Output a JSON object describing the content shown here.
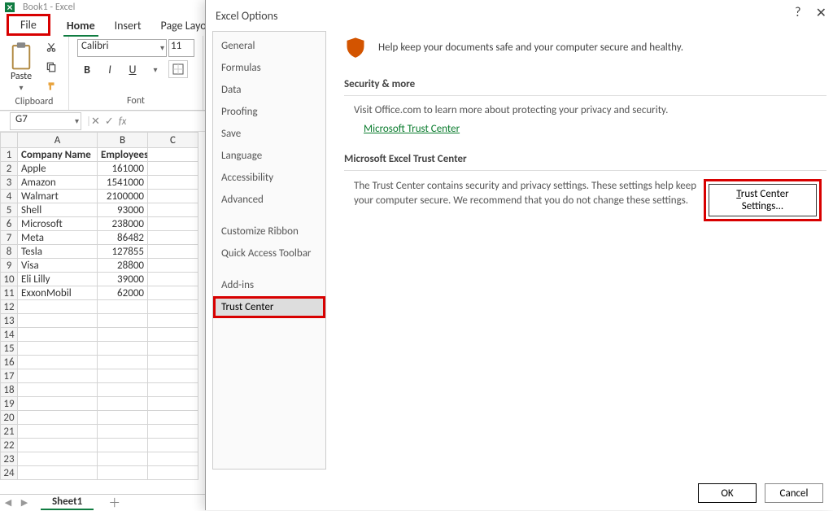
{
  "title": "Book1 - Excel",
  "ribbon": {
    "tabs": [
      "File",
      "Home",
      "Insert",
      "Page Layout"
    ],
    "active": 1,
    "clipboard_label": "Clipboard",
    "paste_label": "Paste",
    "font_label": "Font",
    "font_name": "Calibri",
    "font_size": "11",
    "bold": "B",
    "italic": "I",
    "underline": "U"
  },
  "namebox": "G7",
  "fx_label": "fx",
  "columns": [
    {
      "letter": "A",
      "width": 98
    },
    {
      "letter": "B",
      "width": 62
    },
    {
      "letter": "C",
      "width": 62
    }
  ],
  "header_row": [
    "Company Name",
    "Employees",
    ""
  ],
  "data_rows": [
    [
      "Apple",
      "161000",
      ""
    ],
    [
      "Amazon",
      "1541000",
      ""
    ],
    [
      "Walmart",
      "2100000",
      ""
    ],
    [
      "Shell",
      "93000",
      ""
    ],
    [
      "Microsoft",
      "238000",
      ""
    ],
    [
      "Meta",
      "86482",
      ""
    ],
    [
      "Tesla",
      "127855",
      ""
    ],
    [
      "Visa",
      "28800",
      ""
    ],
    [
      "Eli Lilly",
      "39000",
      ""
    ],
    [
      "ExxonMobil",
      "62000",
      ""
    ]
  ],
  "empty_rows": 13,
  "sheet_tab": "Sheet1",
  "dialog": {
    "title": "Excel Options",
    "categories": [
      "General",
      "Formulas",
      "Data",
      "Proofing",
      "Save",
      "Language",
      "Accessibility",
      "Advanced",
      "Customize Ribbon",
      "Quick Access Toolbar",
      "Add-ins",
      "Trust Center"
    ],
    "selected": "Trust Center",
    "headline": "Help keep your documents safe and your computer secure and healthy.",
    "section1": "Security & more",
    "body1": "Visit Office.com to learn more about protecting your privacy and security.",
    "link": "Microsoft Trust Center",
    "section2": "Microsoft Excel Trust Center",
    "body2": "The Trust Center contains security and privacy settings. These settings help keep your computer secure. We recommend that you do not change these settings.",
    "tc_button": "Trust Center Settings...",
    "ok": "OK",
    "cancel": "Cancel"
  }
}
